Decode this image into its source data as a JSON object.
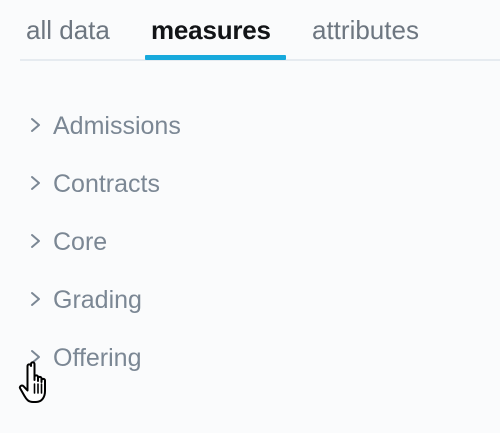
{
  "tabs": {
    "all_data": "all data",
    "measures": "measures",
    "attributes": "attributes",
    "active": "measures"
  },
  "folders": [
    {
      "label": "Admissions",
      "icon": "chevron-right-icon"
    },
    {
      "label": "Contracts",
      "icon": "chevron-right-icon"
    },
    {
      "label": "Core",
      "icon": "chevron-right-icon"
    },
    {
      "label": "Grading",
      "icon": "chevron-right-icon"
    },
    {
      "label": "Offering",
      "icon": "chevron-right-icon"
    }
  ],
  "cursor": {
    "icon": "hand-pointer-icon"
  },
  "colors": {
    "active_tab_underline": "#17a9dc",
    "active_tab_text": "#121417",
    "inactive_tab_text": "#6d7680",
    "folder_text": "#7b8794",
    "background": "#fafbfc"
  }
}
